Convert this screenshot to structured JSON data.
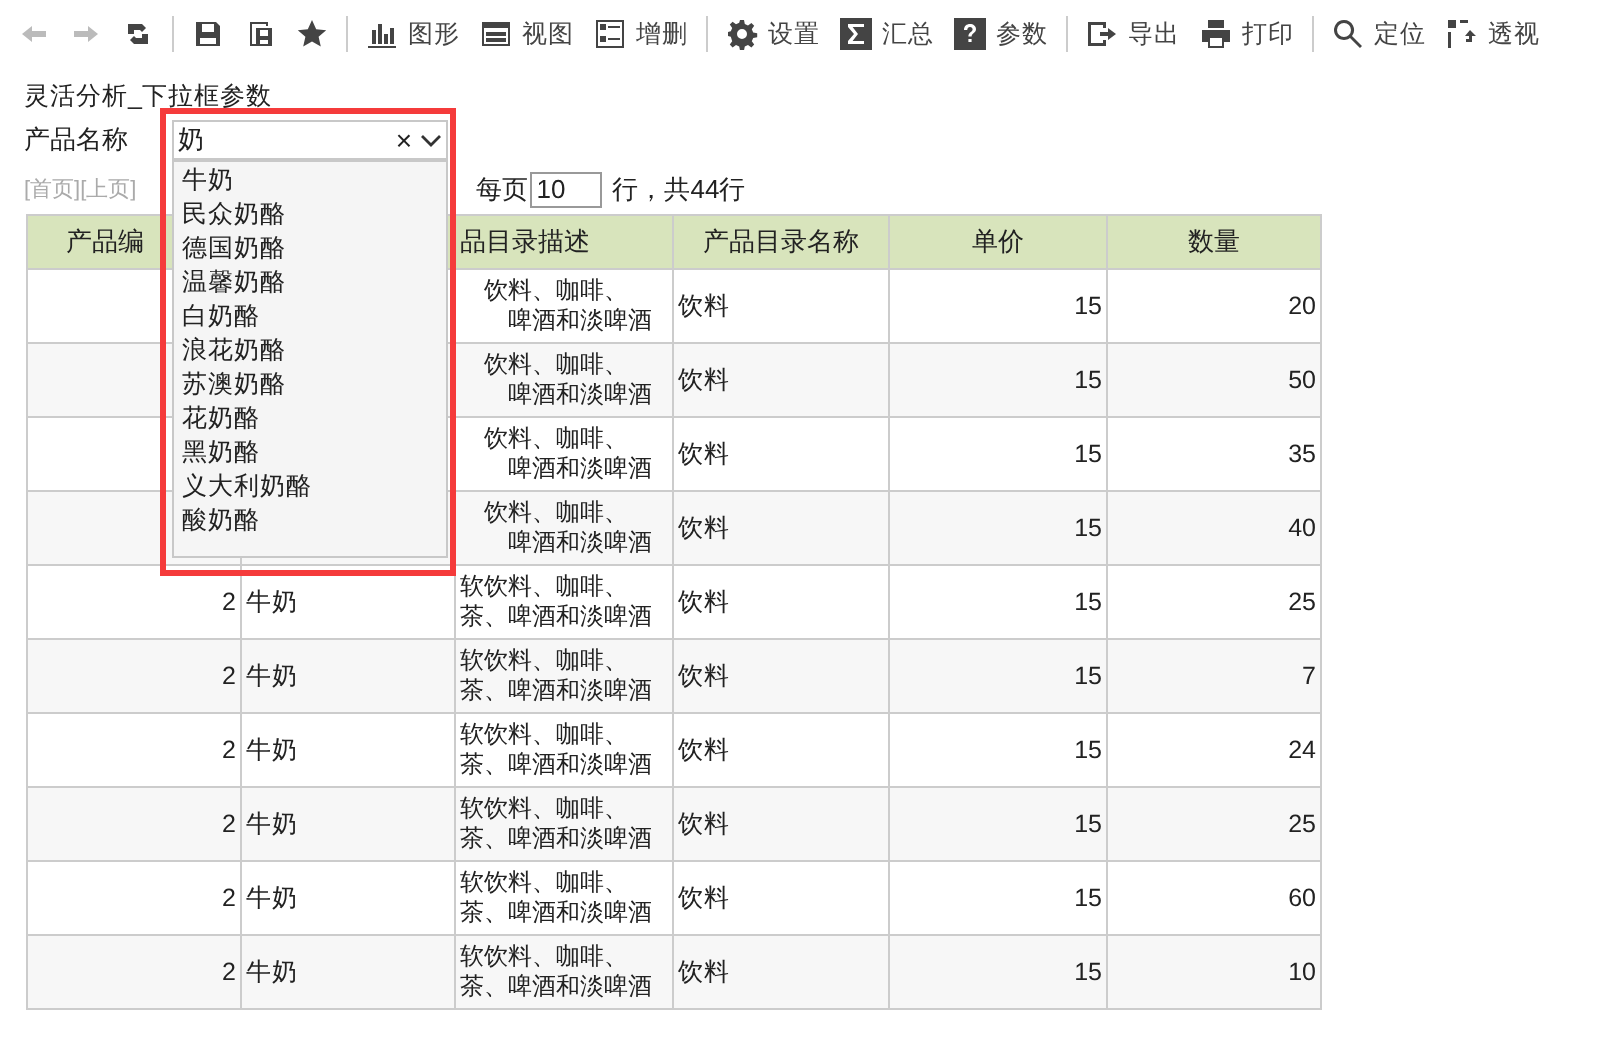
{
  "toolbar": [
    {
      "disabled": true
    },
    {
      "disabled": true
    },
    {
      "disabled": false
    },
    {
      "disabled": false
    },
    {
      "disabled": false
    },
    {
      "disabled": false
    },
    {
      "label": "图形",
      "disabled": false
    },
    {
      "label": "视图",
      "disabled": false
    },
    {
      "label": "增删",
      "disabled": false
    },
    {
      "label": "设置",
      "disabled": false
    },
    {
      "label": "汇总",
      "disabled": false
    },
    {
      "label": "参数",
      "disabled": false
    },
    {
      "label": "导出",
      "disabled": false
    },
    {
      "label": "打印",
      "disabled": false
    },
    {
      "label": "定位",
      "disabled": false
    },
    {
      "label": "透视",
      "disabled": false
    }
  ],
  "report_title": "灵活分析_下拉框参数",
  "parameter": {
    "label": "产品名称",
    "value": "奶",
    "clear": "×",
    "options": [
      "牛奶",
      "民众奶酪",
      "德国奶酪",
      "温馨奶酪",
      "白奶酪",
      "浪花奶酪",
      "苏澳奶酪",
      "花奶酪",
      "黑奶酪",
      "义大利奶酪",
      "酸奶酪"
    ]
  },
  "pager": {
    "nav": "[首页][上页]",
    "per_page_label": "每页",
    "per_page": "10",
    "total": "行，共44行"
  },
  "table": {
    "columns": [
      "产品编",
      null,
      "品目录描述",
      "产品目录名称",
      "单价",
      "数量"
    ],
    "rows": [
      [
        null,
        null,
        [
          "饮料、咖啡、",
          "啤酒和淡啤酒"
        ],
        "饮料",
        "15",
        "20"
      ],
      [
        null,
        null,
        [
          "饮料、咖啡、",
          "啤酒和淡啤酒"
        ],
        "饮料",
        "15",
        "50"
      ],
      [
        null,
        null,
        [
          "饮料、咖啡、",
          "啤酒和淡啤酒"
        ],
        "饮料",
        "15",
        "35"
      ],
      [
        null,
        null,
        [
          "饮料、咖啡、",
          "啤酒和淡啤酒"
        ],
        "饮料",
        "15",
        "40"
      ],
      [
        "2",
        "牛奶",
        "软饮料、咖啡、茶、啤酒和淡啤酒",
        "饮料",
        "15",
        "25"
      ],
      [
        "2",
        "牛奶",
        "软饮料、咖啡、茶、啤酒和淡啤酒",
        "饮料",
        "15",
        "7"
      ],
      [
        "2",
        "牛奶",
        "软饮料、咖啡、茶、啤酒和淡啤酒",
        "饮料",
        "15",
        "24"
      ],
      [
        "2",
        "牛奶",
        "软饮料、咖啡、茶、啤酒和淡啤酒",
        "饮料",
        "15",
        "25"
      ],
      [
        "2",
        "牛奶",
        "软饮料、咖啡、茶、啤酒和淡啤酒",
        "饮料",
        "15",
        "60"
      ],
      [
        "2",
        "牛奶",
        "软饮料、咖啡、茶、啤酒和淡啤酒",
        "饮料",
        "15",
        "10"
      ]
    ]
  }
}
